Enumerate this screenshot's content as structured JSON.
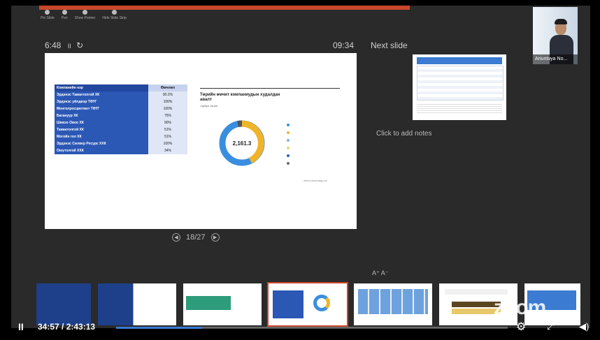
{
  "toolbar": {
    "items": [
      "Pin Slide",
      "Pen",
      "Show Pointer",
      "Hide Slide Strip"
    ]
  },
  "presenter": {
    "elapsed": "6:48",
    "pause_glyph": "II",
    "restart_glyph": "↻",
    "clock": "09:34",
    "next_slide_label": "Next slide",
    "notes_placeholder": "Click to add notes",
    "text_size_label": "A⁺ A⁻"
  },
  "slide": {
    "table_header": [
      "Компанийн нэр",
      "Өмчлөл"
    ],
    "rows": [
      [
        "Эрдэнэс Тавантолгой ХК",
        "90.2%"
      ],
      [
        "Эрдэнэс уйлдвэр ТӨҮГ",
        "100%"
      ],
      [
        "Монголросцветмет ТӨҮГ",
        "100%"
      ],
      [
        "Багануур ХК",
        "75%"
      ],
      [
        "Шивээ Овоо ХК",
        "90%"
      ],
      [
        "Тавантолгой ХК",
        "51%"
      ],
      [
        "Могойн гол ХК",
        "51%"
      ],
      [
        "Эрдэнэс Силвер Ресурс ХХК",
        "100%"
      ],
      [
        "Оюутолгой ХХК",
        "34%"
      ]
    ],
    "chart_title": "Төрийн өмчит компаниудын худалдан авалт",
    "chart_sub": "тэрбум төгрөг",
    "donut_center": "2,161.3",
    "footer": "www.olonnutag.mn"
  },
  "navigation": {
    "position": "18/27",
    "prev_glyph": "◀",
    "next_glyph": "▶"
  },
  "webcam": {
    "name": "Ariuntuya No..."
  },
  "player": {
    "time": "34:57 / 2:43:13",
    "progress": 0.22,
    "play_glyph": "II",
    "gear_glyph": "⚙",
    "full_glyph": "⤢",
    "vol_glyph": "◀)"
  },
  "watermark": "zoom",
  "colors": {
    "accent": "#c9482b",
    "table_blue": "#2b57b5",
    "progress": "#3a7bd5"
  }
}
